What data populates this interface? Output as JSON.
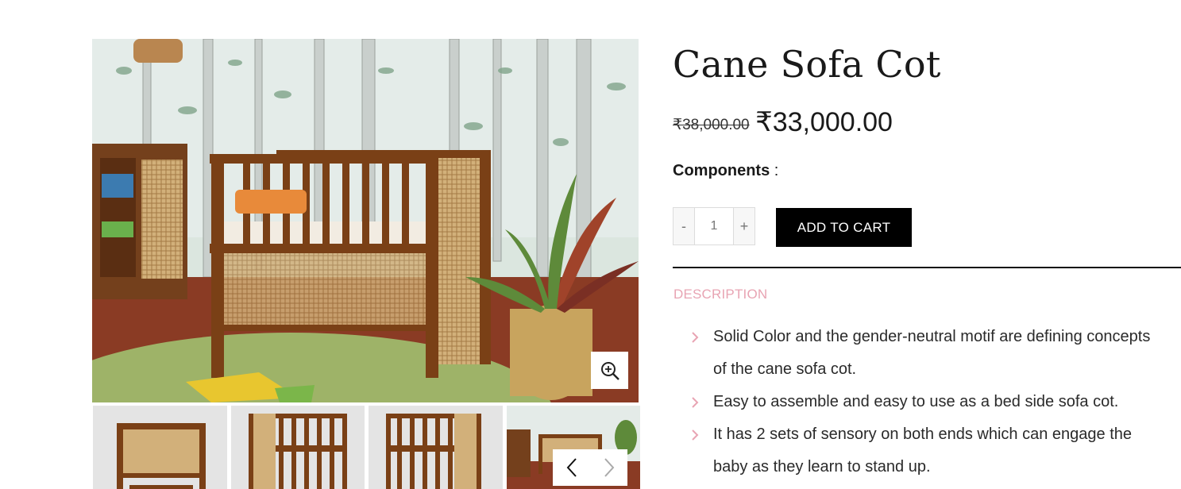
{
  "product": {
    "title": "Cane Sofa Cot",
    "price_old": "₹38,000.00",
    "price_new": "₹33,000.00",
    "components_label": "Components",
    "components_sep": " :",
    "quantity": "1",
    "qty_minus": "-",
    "qty_plus": "+",
    "add_to_cart": "ADD TO CART"
  },
  "gallery": {
    "zoom_icon": "zoom-in-icon",
    "thumb_count": 4,
    "prev_icon": "chevron-left-icon",
    "next_icon": "chevron-right-icon"
  },
  "tabs": {
    "description": "DESCRIPTION"
  },
  "description": {
    "bullets": [
      {
        "line1": "Solid Color and the gender-neutral motif are defining concepts",
        "line2": "of the cane sofa cot."
      },
      {
        "line1": "Easy to assemble and easy to use as a bed side sofa cot.",
        "line2": ""
      },
      {
        "line1": "It has 2 sets of sensory on both ends which can engage the",
        "line2": "baby as they learn to stand up."
      }
    ]
  },
  "colors": {
    "accent_pink": "#e8a4b3",
    "button_black": "#000000",
    "wood": "#7a4016"
  }
}
